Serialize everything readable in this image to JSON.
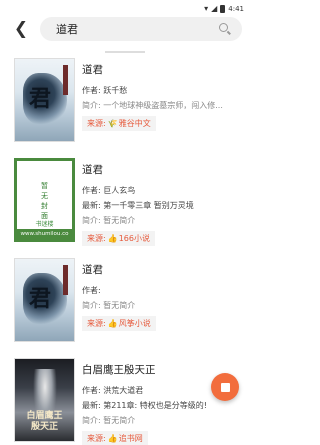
{
  "status_bar": {
    "time": "4:41"
  },
  "search": {
    "query": "道君"
  },
  "results": [
    {
      "title": "道君",
      "lines": [
        {
          "text": "作者: 跃千愁",
          "gray": false
        },
        {
          "text": "简介: 一个地球神级盗墓宗师，闯入修...",
          "gray": true
        }
      ],
      "source_prefix": "来源:",
      "source_icon": "🌾",
      "source_name": "雅谷中文",
      "cover_style": "ink",
      "cover_char": "君"
    },
    {
      "title": "道君",
      "lines": [
        {
          "text": "作者: 巨人玄鸟",
          "gray": false
        },
        {
          "text": "最新: 第一千零三章 暂别万灵境",
          "gray": false
        },
        {
          "text": "简介: 暂无简介",
          "gray": true
        }
      ],
      "source_prefix": "来源:",
      "source_icon": "👍",
      "source_name": "166小说",
      "cover_style": "plain",
      "cover_nocover": "暂\n无\n封\n面",
      "cover_brand": "书迷楼",
      "cover_site": "www.shumilou.co"
    },
    {
      "title": "道君",
      "lines": [
        {
          "text": "作者:",
          "gray": false
        },
        {
          "text": "简介: 暂无简介",
          "gray": true
        }
      ],
      "source_prefix": "来源:",
      "source_icon": "👍",
      "source_name": "风筝小说",
      "cover_style": "ink",
      "cover_char": "君"
    },
    {
      "title": "白眉鹰王殷天正",
      "lines": [
        {
          "text": "作者: 洪荒大道君",
          "gray": false
        },
        {
          "text": "最新: 第211章: 特权也是分等级的!",
          "gray": false
        },
        {
          "text": "简介: 暂无简介",
          "gray": true
        }
      ],
      "source_prefix": "来源:",
      "source_icon": "👍",
      "source_name": "追书网",
      "cover_style": "dark",
      "cover_title": "白眉鹰王\n殷天正"
    }
  ],
  "icons": {
    "back": "arrow-left-icon",
    "search": "search-icon",
    "fab": "stop-icon"
  },
  "colors": {
    "accent": "#f26d3d",
    "source_text": "#e65a3c"
  }
}
